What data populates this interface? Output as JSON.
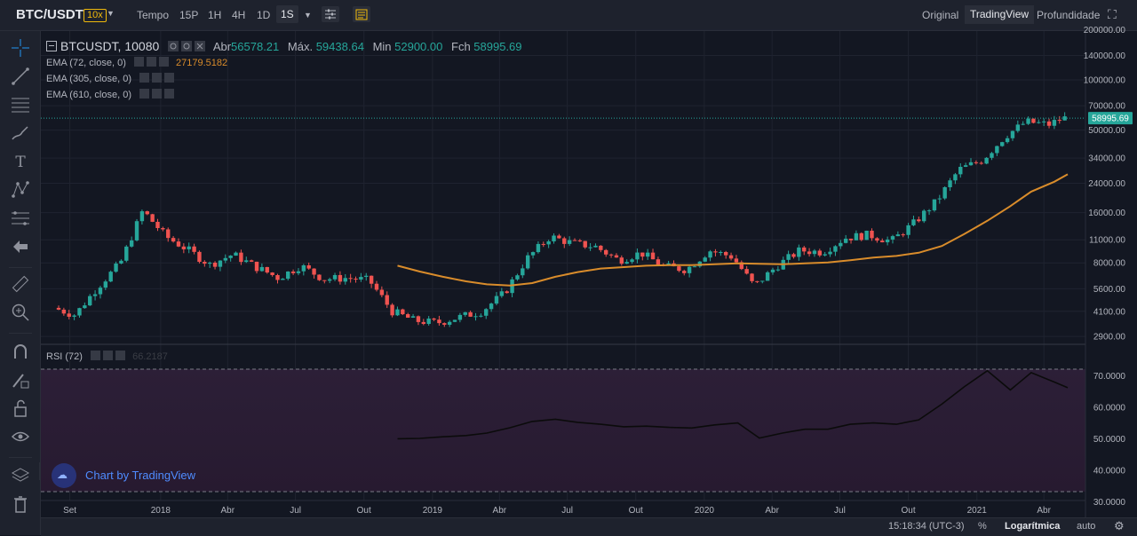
{
  "header": {
    "pair": "BTC/USDT",
    "leverage": "10x",
    "time_label": "Tempo",
    "intervals": [
      "15P",
      "1H",
      "4H",
      "1D",
      "1S"
    ],
    "active_interval": "1S",
    "views": [
      "Original",
      "TradingView",
      "Profundidade"
    ],
    "active_view": "TradingView"
  },
  "legend": {
    "symbol": "BTCUSDT, 10080",
    "open_label": "Abr",
    "open": "56578.21",
    "high_label": "Máx.",
    "high": "59438.64",
    "low_label": "Min",
    "low": "52900.00",
    "close_label": "Fch",
    "close": "58995.69",
    "ema1_label": "EMA (72, close, 0)",
    "ema1_value": "27179.5182",
    "ema2_label": "EMA (305, close, 0)",
    "ema3_label": "EMA (610, close, 0)",
    "rsi_label": "RSI (72)",
    "rsi_value": "66.2187"
  },
  "price_axis": {
    "ticks": [
      "200000.00",
      "140000.00",
      "100000.00",
      "70000.00",
      "50000.00",
      "34000.00",
      "24000.00",
      "16000.00",
      "11000.00",
      "8000.00",
      "5600.00",
      "4100.00",
      "2900.00"
    ],
    "last_price": "58995.69"
  },
  "rsi_axis": {
    "ticks": [
      "70.0000",
      "60.0000",
      "50.0000",
      "40.0000",
      "30.0000"
    ]
  },
  "time_axis": [
    "Set",
    "2018",
    "Abr",
    "Jul",
    "Out",
    "2019",
    "Abr",
    "Jul",
    "Out",
    "2020",
    "Abr",
    "Jul",
    "Out",
    "2021",
    "Abr"
  ],
  "watermark": "Chart by TradingView",
  "bottom": {
    "time": "15:18:34 (UTC-3)",
    "percent": "%",
    "log": "Logarítmica",
    "auto": "auto"
  },
  "colors": {
    "up": "#26a69a",
    "down": "#ef5350",
    "ema": "#d98c2b",
    "last_price": "#26a69a",
    "rsi_line": "#0b0b0b",
    "rsi_band": "#2a1c34"
  },
  "chart_data": {
    "type": "line",
    "x": [
      "2017-08-17",
      "2017-09-15",
      "2017-10-15",
      "2017-11-15",
      "2017-12-15",
      "2018-01-15",
      "2018-02-15",
      "2018-03-15",
      "2018-04-15",
      "2018-05-15",
      "2018-06-15",
      "2018-07-15",
      "2018-08-15",
      "2018-09-15",
      "2018-10-15",
      "2018-11-15",
      "2018-12-15",
      "2019-01-15",
      "2019-02-15",
      "2019-03-15",
      "2019-04-15",
      "2019-05-15",
      "2019-06-15",
      "2019-07-15",
      "2019-08-15",
      "2019-09-15",
      "2019-10-15",
      "2019-11-15",
      "2019-12-15",
      "2020-01-15",
      "2020-02-15",
      "2020-03-15",
      "2020-04-15",
      "2020-05-15",
      "2020-06-15",
      "2020-07-15",
      "2020-08-15",
      "2020-09-15",
      "2020-10-15",
      "2020-11-15",
      "2020-12-15",
      "2021-01-15",
      "2021-02-15",
      "2021-03-15",
      "2021-04-15",
      "2021-05-03"
    ],
    "series": [
      {
        "name": "BTCUSDT",
        "values": [
          4300,
          3900,
          5700,
          8000,
          16500,
          11500,
          9500,
          7800,
          9000,
          7600,
          6500,
          7700,
          6400,
          6500,
          6300,
          4100,
          3600,
          3500,
          3800,
          4100,
          5300,
          8500,
          11500,
          10500,
          10000,
          8300,
          9200,
          7600,
          7300,
          9500,
          8700,
          5800,
          7700,
          9500,
          9300,
          11300,
          11800,
          10800,
          13800,
          18800,
          29000,
          33000,
          46000,
          56000,
          54000,
          58995.69
        ]
      },
      {
        "name": "EMA (72, close, 0)",
        "values": [
          null,
          null,
          null,
          null,
          null,
          null,
          null,
          null,
          null,
          null,
          null,
          null,
          null,
          null,
          null,
          7700,
          7100,
          6600,
          6200,
          5950,
          5850,
          6050,
          6600,
          7050,
          7400,
          7550,
          7700,
          7750,
          7750,
          7850,
          7950,
          7900,
          7850,
          7950,
          8050,
          8300,
          8600,
          8800,
          9200,
          10100,
          11900,
          14300,
          17500,
          21400,
          24500,
          27179.5182
        ]
      }
    ],
    "rsi": {
      "name": "RSI (72)",
      "values": [
        null,
        null,
        null,
        null,
        null,
        null,
        null,
        null,
        null,
        null,
        null,
        null,
        null,
        null,
        null,
        50.0,
        50.1,
        50.6,
        51.0,
        51.8,
        53.5,
        55.5,
        56.2,
        55.2,
        54.6,
        53.8,
        54.0,
        53.6,
        53.4,
        54.4,
        55.0,
        50.2,
        51.8,
        53.0,
        53.0,
        54.6,
        55.0,
        54.6,
        56.0,
        61.0,
        66.5,
        71.6,
        65.5,
        71.0,
        68.0,
        66.2187
      ],
      "levels": [
        70,
        30
      ],
      "ylim": [
        25,
        80
      ]
    },
    "ylim": [
      2600,
      230000
    ],
    "log_scale": true,
    "grid": true
  }
}
